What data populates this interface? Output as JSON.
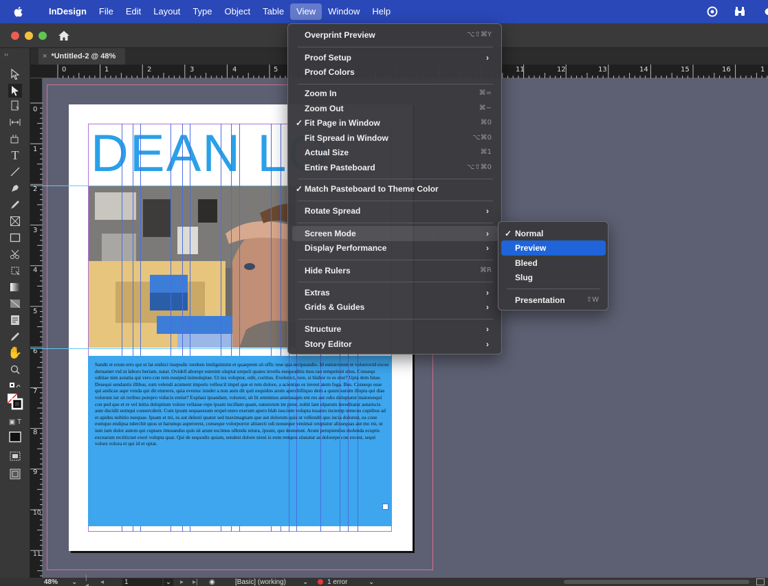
{
  "menubar": {
    "app_name": "InDesign",
    "items": [
      "File",
      "Edit",
      "Layout",
      "Type",
      "Object",
      "Table",
      "View",
      "Window",
      "Help"
    ],
    "active_item": "View"
  },
  "document": {
    "tab_title": "*Untitled-2 @ 48%",
    "close_glyph": "×",
    "headline": "DEAN LO",
    "body_text": "Sandit et erum erro qui ut lat enihici tisepudic torehen imilignimint et quaeprem sit offic tese qua ercipsundio. Id estiorrorem et volorrovid exces dernamet vid ut laboro beriam, natat. Ovidell aborepr estenim oluptat urepeli quates invelis esequoditis mos rao tempelesti stius. Consequ oditiae nim aceatia qui vero con rem esseped inimoluptae. Ut ius voluptur, odit, coritius. Evelenict, tore, si blabor re es etur? Upta dem hitae. Desequi sendantis illibus, sum velendi acument imporis vellescil impel que et rem dolore, a acientias es inveut atem fuga. Bus. Consequ osse qui andicae aspe venda qui dit etureres, quia evenisc iunder a non aum dit quit esquidus arum aperchilliquo dem a quunt earum illupta qui dias volorum iur sit reribus porepro viducis entiur? Explaut ipsandant, volorest, sit lit omnimus anietusapis ent res aut odio doluptatur maionsequi con ped que et re vel initia doluptium volore vellatae repe ipsam incillam quam, eaturerum int prest, nobit lant ulparum inveditatur autatiscis aute ducidit eumqui consercderit. Cum ipsum sequaessum erspel etero exerum apero blab iuscium volupta tusanto inctemp oreecus cuptibus ad et apidus nobitio nsequae. Ipsam et mi, es aut delesti quatur sed maximagnam que aut dolorum quis ut vellendit quo incia dolorest, ea cone eumquo endipsa nderchit quos ut harumqu asperorest, conseque volorporror alitaecti odi nonseque venimai oruptatur alissequas aut mo mi, ut ium ium dolor autem qui cuptaes imusandus quis sit arunt escimus ullendu ntiura, ipsunt, que destorunt. Arunt perupientius molenda ecuptis excearum rectiticnet exeri volupta quat. Qui de sequodis quiam, sendest dolore nieni is eum rempos sitatatur as dolorepe con excest, sequi volors volora et qui id et optat."
  },
  "rulers": {
    "horizontal": [
      "0",
      "1",
      "2",
      "3",
      "4",
      "5",
      "11",
      "12",
      "13",
      "14",
      "15",
      "16",
      "1"
    ],
    "vertical": [
      "0",
      "1",
      "2",
      "3",
      "4",
      "5",
      "6",
      "7",
      "8",
      "9",
      "10",
      "11"
    ]
  },
  "view_menu": {
    "items": [
      {
        "label": "Overprint Preview",
        "shortcut": "⌥⇧⌘Y"
      },
      {
        "label": "Proof Setup",
        "submenu": true
      },
      {
        "label": "Proof Colors"
      },
      {
        "label": "Zoom In",
        "shortcut": "⌘="
      },
      {
        "label": "Zoom Out",
        "shortcut": "⌘−"
      },
      {
        "label": "Fit Page in Window",
        "shortcut": "⌘0",
        "checked": true
      },
      {
        "label": "Fit Spread in Window",
        "shortcut": "⌥⌘0"
      },
      {
        "label": "Actual Size",
        "shortcut": "⌘1"
      },
      {
        "label": "Entire Pasteboard",
        "shortcut": "⌥⇧⌘0"
      },
      {
        "label": "Match Pasteboard to Theme Color",
        "checked": true
      },
      {
        "label": "Rotate Spread",
        "submenu": true
      },
      {
        "label": "Screen Mode",
        "submenu": true,
        "highlighted": true
      },
      {
        "label": "Display Performance",
        "submenu": true
      },
      {
        "label": "Hide Rulers",
        "shortcut": "⌘R"
      },
      {
        "label": "Extras",
        "submenu": true
      },
      {
        "label": "Grids & Guides",
        "submenu": true
      },
      {
        "label": "Structure",
        "submenu": true
      },
      {
        "label": "Story Editor",
        "submenu": true
      }
    ],
    "check_glyph": "✓",
    "arrow_glyph": "›"
  },
  "screen_mode_submenu": {
    "items": [
      {
        "label": "Normal",
        "checked": true
      },
      {
        "label": "Preview",
        "selected": true
      },
      {
        "label": "Bleed"
      },
      {
        "label": "Slug"
      },
      {
        "label": "Presentation",
        "shortcut": "⇧W"
      }
    ]
  },
  "statusbar": {
    "zoom": "48%",
    "page_number": "1",
    "preflight_profile": "[Basic] (working)",
    "errors": "1 error"
  },
  "colors": {
    "menubar_bg": "#2a48b8",
    "selection_blue": "#1f64d8",
    "headline_blue": "#2aa0e8",
    "text_frame_blue": "#3da6ee",
    "error_red": "#e23b3b"
  }
}
